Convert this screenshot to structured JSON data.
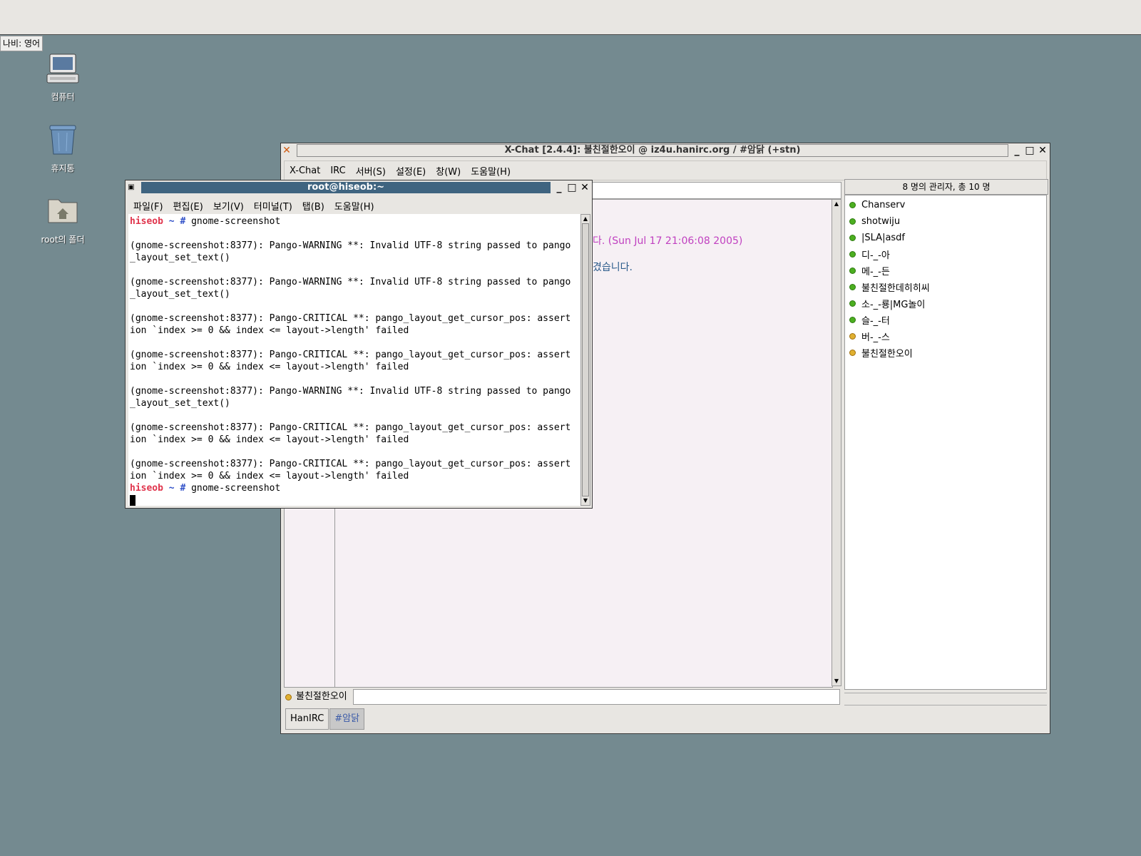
{
  "ime": {
    "label": "나비: 영어"
  },
  "desktop": {
    "icons": [
      {
        "label": "컴퓨터",
        "icon": "computer-icon"
      },
      {
        "label": "휴지통",
        "icon": "trash-icon"
      },
      {
        "label": "root의 폴더",
        "icon": "home-folder-icon"
      }
    ]
  },
  "xchat": {
    "title": "X-Chat [2.4.4]: 불친절한오이 @ iz4u.hanirc.org / #암닭 (+stn)",
    "menu": [
      "X-Chat",
      "IRC",
      "서버(S)",
      "설정(E)",
      "창(W)",
      "도움말(H)"
    ],
    "chat_lines": [
      {
        "text": "다. (Sun Jul 17 21:06:08 2005)",
        "color": "#c040c0"
      },
      {
        "text": "겼습니다.",
        "color": "#2a5a8a"
      }
    ],
    "userlist_header": "8 명의 관리자, 총 10 명",
    "users": [
      {
        "nick": "Chanserv",
        "mode": "op"
      },
      {
        "nick": "shotwiju",
        "mode": "op"
      },
      {
        "nick": "|SLA|asdf",
        "mode": "op"
      },
      {
        "nick": "디-_-아",
        "mode": "op"
      },
      {
        "nick": "메-_-든",
        "mode": "op"
      },
      {
        "nick": "불친절한데히히씨",
        "mode": "op"
      },
      {
        "nick": "소-_-룡|MG놀이",
        "mode": "op"
      },
      {
        "nick": "슬-_-터",
        "mode": "op"
      },
      {
        "nick": "버-_-스",
        "mode": "voice"
      },
      {
        "nick": "불친절한오이",
        "mode": "voice"
      }
    ],
    "nick": "불친절한오이",
    "tabs": [
      {
        "label": "HanIRC",
        "active": false
      },
      {
        "label": "#암닭",
        "active": true
      }
    ]
  },
  "terminal": {
    "title": "root@hiseob:~",
    "menu": [
      "파일(F)",
      "편집(E)",
      "보기(V)",
      "터미널(T)",
      "탭(B)",
      "도움말(H)"
    ],
    "prompt_user": "hiseob",
    "prompt_sym": "~ #",
    "lines": [
      {
        "type": "prompt",
        "cmd": "gnome-screenshot"
      },
      {
        "type": "text",
        "text": ""
      },
      {
        "type": "text",
        "text": "(gnome-screenshot:8377): Pango-WARNING **: Invalid UTF-8 string passed to pango"
      },
      {
        "type": "text",
        "text": "_layout_set_text()"
      },
      {
        "type": "text",
        "text": ""
      },
      {
        "type": "text",
        "text": "(gnome-screenshot:8377): Pango-WARNING **: Invalid UTF-8 string passed to pango"
      },
      {
        "type": "text",
        "text": "_layout_set_text()"
      },
      {
        "type": "text",
        "text": ""
      },
      {
        "type": "text",
        "text": "(gnome-screenshot:8377): Pango-CRITICAL **: pango_layout_get_cursor_pos: assert"
      },
      {
        "type": "text",
        "text": "ion `index >= 0 && index <= layout->length' failed"
      },
      {
        "type": "text",
        "text": ""
      },
      {
        "type": "text",
        "text": "(gnome-screenshot:8377): Pango-CRITICAL **: pango_layout_get_cursor_pos: assert"
      },
      {
        "type": "text",
        "text": "ion `index >= 0 && index <= layout->length' failed"
      },
      {
        "type": "text",
        "text": ""
      },
      {
        "type": "text",
        "text": "(gnome-screenshot:8377): Pango-WARNING **: Invalid UTF-8 string passed to pango"
      },
      {
        "type": "text",
        "text": "_layout_set_text()"
      },
      {
        "type": "text",
        "text": ""
      },
      {
        "type": "text",
        "text": "(gnome-screenshot:8377): Pango-CRITICAL **: pango_layout_get_cursor_pos: assert"
      },
      {
        "type": "text",
        "text": "ion `index >= 0 && index <= layout->length' failed"
      },
      {
        "type": "text",
        "text": ""
      },
      {
        "type": "text",
        "text": "(gnome-screenshot:8377): Pango-CRITICAL **: pango_layout_get_cursor_pos: assert"
      },
      {
        "type": "text",
        "text": "ion `index >= 0 && index <= layout->length' failed"
      },
      {
        "type": "prompt",
        "cmd": "gnome-screenshot"
      },
      {
        "type": "cursor"
      }
    ]
  }
}
